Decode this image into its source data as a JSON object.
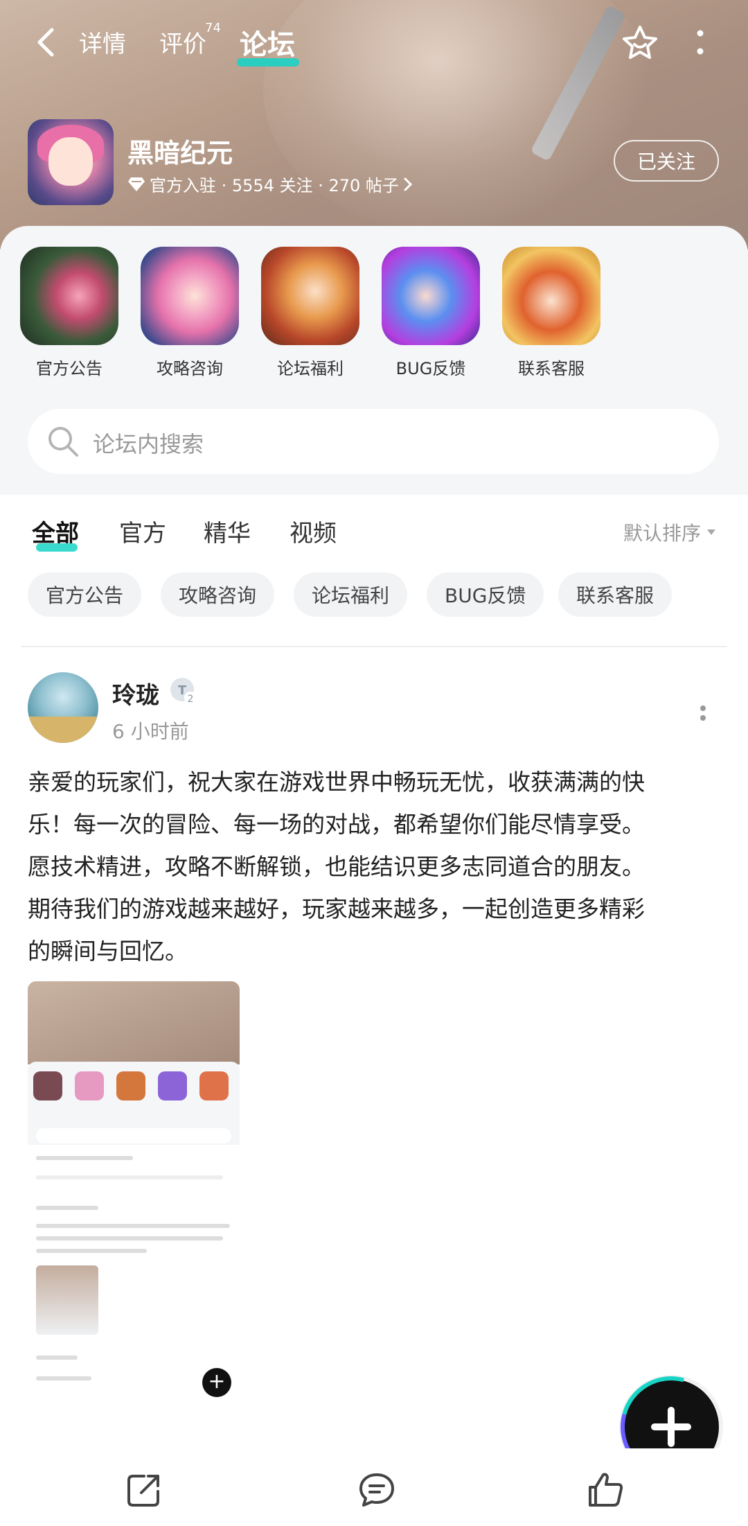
{
  "topbar": {
    "tabs": [
      "详情",
      "评价",
      "论坛"
    ],
    "active_tab": "论坛",
    "review_count": "74"
  },
  "game": {
    "title": "黑暗纪元",
    "meta": "官方入驻 · 5554 关注 · 270 帖子",
    "follow_label": "已关注"
  },
  "shortcuts": [
    "官方公告",
    "攻略咨询",
    "论坛福利",
    "BUG反馈",
    "联系客服"
  ],
  "search": {
    "placeholder": "论坛内搜索"
  },
  "filter_tabs": [
    "全部",
    "官方",
    "精华",
    "视频"
  ],
  "sort_label": "默认排序",
  "chips": [
    "官方公告",
    "攻略咨询",
    "论坛福利",
    "BUG反馈",
    "联系客服"
  ],
  "post": {
    "author": "玲珑",
    "badge_level": "2",
    "time": "6 小时前",
    "lines": [
      "亲爱的玩家们，祝大家在游戏世界中畅玩无忧，收获满满的快",
      "乐！每一次的冒险、每一场的对战，都希望你们能尽情享受。",
      "愿技术精进，攻略不断解锁，也能结识更多志同道合的朋友。",
      "期待我们的游戏越来越好，玩家越来越多，一起创造更多精彩",
      "的瞬间与回忆。"
    ]
  },
  "colors": {
    "accent": "#19d3c5",
    "header_bg": "#b99e8c"
  },
  "icons": {
    "back": "back-arrow-icon",
    "star": "star-icon",
    "more": "more-vertical-icon",
    "share": "share-icon",
    "comment": "comment-icon",
    "like": "thumb-up-icon",
    "add": "plus-icon"
  }
}
